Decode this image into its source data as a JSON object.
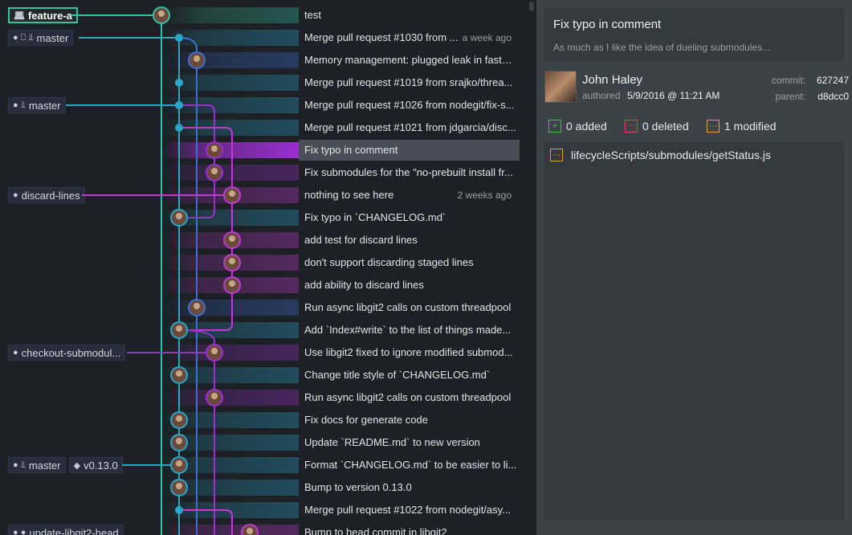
{
  "graph": {
    "rows": [
      {
        "message": "test",
        "date": "",
        "refs": [
          {
            "kind": "active",
            "icons": "laptop-icon",
            "label": "feature-a"
          }
        ],
        "colors": {
          "band": "#36c2a6"
        }
      },
      {
        "message": "Merge pull request #1030 from ...",
        "date": "a week ago",
        "refs": [
          {
            "kind": "normal",
            "icons": "github-laptop-head-icon",
            "label": "master"
          }
        ],
        "colors": {
          "band": "#2aa6c9"
        }
      },
      {
        "message": "Memory management: plugged leak in fastW...",
        "date": "",
        "refs": [],
        "colors": {
          "band": "#3c6fd3"
        }
      },
      {
        "message": "Merge pull request #1019 from srajko/threa...",
        "date": "",
        "refs": [],
        "colors": {
          "band": "#2aa6c9"
        }
      },
      {
        "message": "Merge pull request #1026 from nodegit/fix-s...",
        "date": "",
        "refs": [
          {
            "kind": "normal",
            "icons": "github-head-icon",
            "label": "master"
          }
        ],
        "colors": {
          "band": "#2aa6c9"
        }
      },
      {
        "message": "Merge pull request #1021 from jdgarcia/disc...",
        "date": "",
        "refs": [],
        "colors": {
          "band": "#2aa6c9"
        }
      },
      {
        "message": "Fix typo in comment",
        "date": "",
        "refs": [],
        "colors": {
          "band": "#9b2fd0"
        },
        "selected": true
      },
      {
        "message": "Fix submodules for the \"no-prebuilt install fr...",
        "date": "",
        "refs": [],
        "colors": {
          "band": "#9b2fd0"
        }
      },
      {
        "message": "nothing to see here",
        "date": "2 weeks ago",
        "refs": [
          {
            "kind": "normal",
            "icons": "github-icon",
            "label": "discard-lines"
          }
        ],
        "colors": {
          "band": "#c03bd3"
        }
      },
      {
        "message": "Fix typo in `CHANGELOG.md`",
        "date": "",
        "refs": [],
        "colors": {
          "band": "#2aa6c9"
        }
      },
      {
        "message": "add test for discard lines",
        "date": "",
        "refs": [],
        "colors": {
          "band": "#c03bd3"
        }
      },
      {
        "message": "don't support discarding staged lines",
        "date": "",
        "refs": [],
        "colors": {
          "band": "#c03bd3"
        }
      },
      {
        "message": "add ability to discard lines",
        "date": "",
        "refs": [],
        "colors": {
          "band": "#c03bd3"
        }
      },
      {
        "message": "Run async libgit2 calls on custom threadpool",
        "date": "",
        "refs": [],
        "colors": {
          "band": "#3c6fd3"
        }
      },
      {
        "message": "Add `Index#write` to the list of things made...",
        "date": "",
        "refs": [],
        "colors": {
          "band": "#2aa6c9"
        }
      },
      {
        "message": "Use libgit2 fixed to ignore modified submod...",
        "date": "",
        "refs": [
          {
            "kind": "normal",
            "icons": "github-icon",
            "label": "checkout-submodul..."
          }
        ],
        "colors": {
          "band": "#9b2fd0"
        }
      },
      {
        "message": "Change title style of `CHANGELOG.md`",
        "date": "",
        "refs": [],
        "colors": {
          "band": "#2aa6c9"
        }
      },
      {
        "message": "Run async libgit2 calls on custom threadpool",
        "date": "",
        "refs": [],
        "colors": {
          "band": "#9b2fd0"
        }
      },
      {
        "message": "Fix docs for generate code",
        "date": "",
        "refs": [],
        "colors": {
          "band": "#2aa6c9"
        }
      },
      {
        "message": "Update `README.md` to new version",
        "date": "",
        "refs": [],
        "colors": {
          "band": "#2aa6c9"
        }
      },
      {
        "message": "Format `CHANGELOG.md` to be easier to li...",
        "date": "",
        "refs": [
          {
            "kind": "normal",
            "icons": "github-head-icon",
            "label": "master"
          },
          {
            "kind": "normal",
            "icons": "tag-icon",
            "label": "v0.13.0"
          }
        ],
        "colors": {
          "band": "#2aa6c9"
        }
      },
      {
        "message": "Bump to version 0.13.0",
        "date": "",
        "refs": [],
        "colors": {
          "band": "#2aa6c9"
        }
      },
      {
        "message": "Merge pull request #1022 from nodegit/asy...",
        "date": "",
        "refs": [],
        "colors": {
          "band": "#2aa6c9"
        }
      },
      {
        "message": "Bump to head commit in libgit2",
        "date": "",
        "refs": [
          {
            "kind": "normal",
            "icons": "github-github-icon",
            "label": "update-libgit2-head"
          }
        ],
        "colors": {
          "band": "#c03bd3"
        }
      }
    ]
  },
  "details": {
    "summary_title": "Fix typo in comment",
    "summary_body": "As much as I like the idea of dueling submodules...",
    "author_name": "John Haley",
    "authored_label": "authored",
    "authored_date": "5/9/2016 @ 11:21 AM",
    "commit_label": "commit:",
    "commit_sha": "627247",
    "parent_label": "parent:",
    "parent_sha": "d8dcc0",
    "added_label": "0 added",
    "deleted_label": "0 deleted",
    "modified_label": "1 modified",
    "files": [
      {
        "path": "lifecycleScripts/submodules/getStatus.js",
        "status": "modified"
      }
    ]
  },
  "colors": {
    "teal": "#36c2a6",
    "cyan": "#2aa6c9",
    "blue": "#3c6fd3",
    "purple": "#9b2fd0",
    "magenta": "#c03bd3",
    "added": "#4fb34f",
    "deleted": "#d64545",
    "modified": "#d8a72a"
  }
}
